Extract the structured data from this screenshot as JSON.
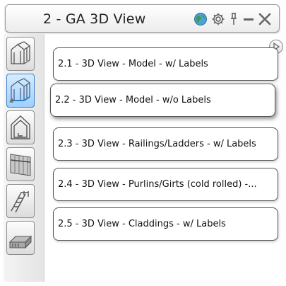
{
  "window": {
    "title": "2 - GA 3D View",
    "icons": [
      "globe-icon",
      "gear-icon",
      "pin-icon",
      "minimize-icon",
      "close-icon"
    ]
  },
  "sidebar": {
    "buttons": [
      {
        "icon": "frame-3d-icon",
        "active": false
      },
      {
        "icon": "frame-3d-blue-icon",
        "active": true
      },
      {
        "icon": "house-elevation-icon",
        "active": false
      },
      {
        "icon": "wall-panel-icon",
        "active": false
      },
      {
        "icon": "stair-ladder-icon",
        "active": false
      },
      {
        "icon": "cladding-profile-icon",
        "active": false
      }
    ]
  },
  "list": {
    "items": [
      {
        "label": "2.1 - 3D View - Model - w/ Labels"
      },
      {
        "label": "2.2 - 3D View - Model - w/o Labels"
      },
      {
        "label": "2.3 - 3D View - Railings/Ladders - w/ Labels"
      },
      {
        "label": "2.4 - 3D View - Purlins/Girts (cold rolled) -..."
      },
      {
        "label": "2.5 - 3D View - Claddings - w/ Labels"
      }
    ],
    "selected_index": 1
  },
  "colors": {
    "active_button": "#9fd0ff",
    "globe": "#2e8b57"
  }
}
